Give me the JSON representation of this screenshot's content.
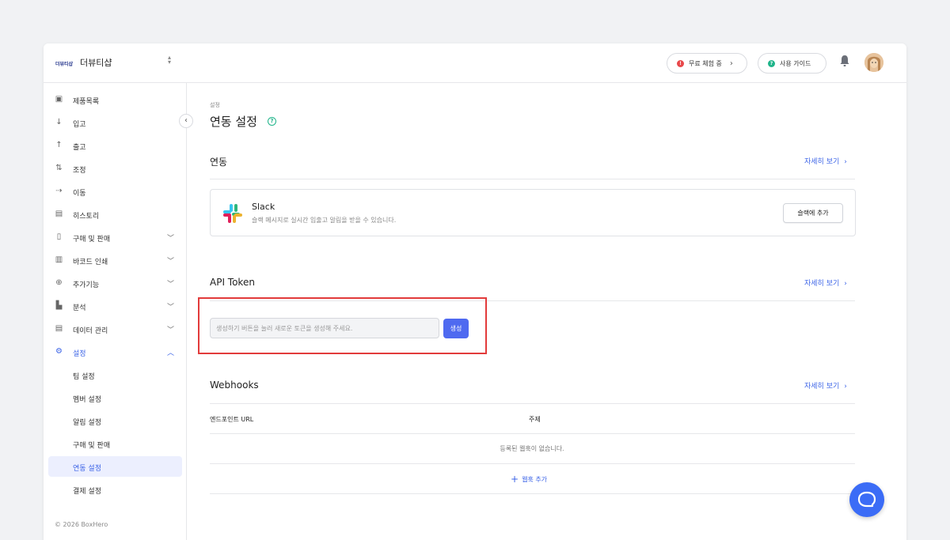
{
  "topbar": {
    "logo_text": "더뷰티샵",
    "team_name": "더뷰티샵",
    "trial_label": "무료 체험 중",
    "guide_label": "사용 가이드"
  },
  "sidebar": {
    "items": [
      {
        "label": "제품목록",
        "icon": "box-icon"
      },
      {
        "label": "입고",
        "icon": "arrow-down-icon"
      },
      {
        "label": "출고",
        "icon": "arrow-up-icon"
      },
      {
        "label": "조정",
        "icon": "adjust-icon"
      },
      {
        "label": "이동",
        "icon": "move-icon"
      },
      {
        "label": "히스토리",
        "icon": "history-icon"
      },
      {
        "label": "구매 및 판매",
        "icon": "document-icon"
      },
      {
        "label": "바코드 인쇄",
        "icon": "barcode-icon"
      },
      {
        "label": "추가기능",
        "icon": "plus-circle-icon"
      },
      {
        "label": "분석",
        "icon": "chart-icon"
      },
      {
        "label": "데이터 관리",
        "icon": "database-icon"
      },
      {
        "label": "설정",
        "icon": "gear-icon"
      }
    ],
    "settings_sub": [
      "팀 설정",
      "멤버 설정",
      "알림 설정",
      "구매 및 판매",
      "연동 설정",
      "결제 설정"
    ],
    "copyright": "© 2026 BoxHero"
  },
  "main": {
    "breadcrumb": "설정",
    "title": "연동 설정",
    "integration": {
      "title": "연동",
      "more": "자세히 보기",
      "slack_name": "Slack",
      "slack_desc": "슬랙 메시지로 실시간 입출고 알림을 받을 수 있습니다.",
      "slack_button": "슬랙에 추가"
    },
    "api": {
      "title": "API Token",
      "more": "자세히 보기",
      "placeholder": "생성하기 버튼을 눌러 새로운 토큰을 생성해 주세요.",
      "generate": "생성"
    },
    "webhooks": {
      "title": "Webhooks",
      "more": "자세히 보기",
      "col_endpoint": "엔드포인트 URL",
      "col_topic": "주제",
      "empty": "등록된 웹훅이 없습니다.",
      "add": "웹훅 추가"
    }
  },
  "colors": {
    "accent": "#3b63e7",
    "highlight": "#e23b3b",
    "trial_dot": "#e8484a",
    "guide_dot": "#1fb48a"
  }
}
